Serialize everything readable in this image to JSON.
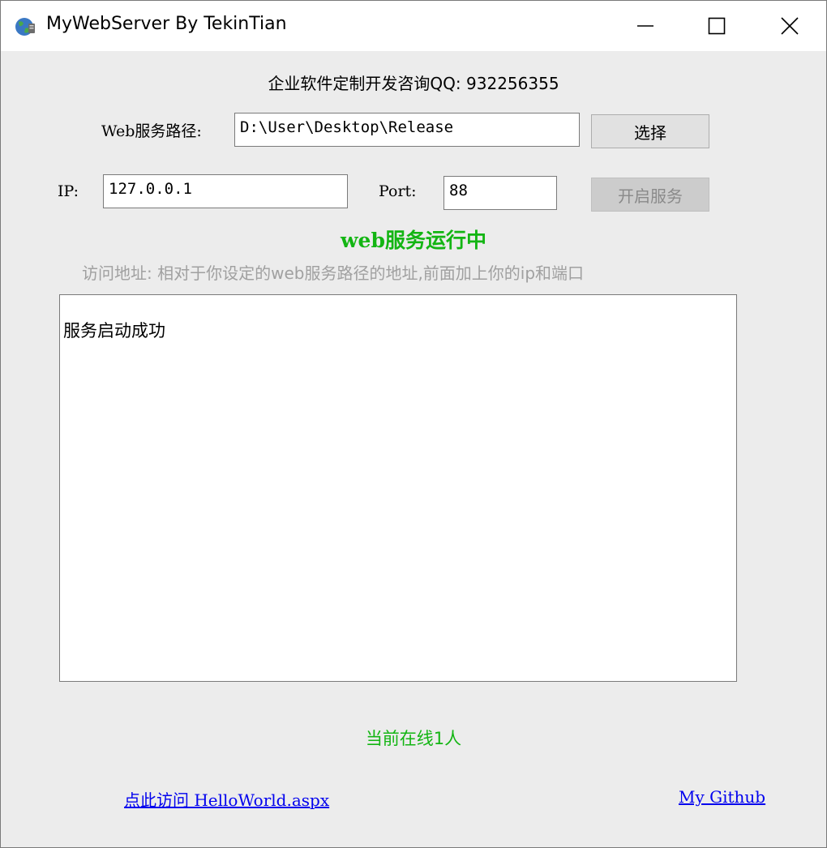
{
  "window": {
    "title": "MyWebServer By TekinTian",
    "icon": "globe-icon"
  },
  "header": {
    "qq_text": "企业软件定制开发咨询QQ: 932256355"
  },
  "path_row": {
    "label": "Web服务路径:",
    "value": "D:\\User\\Desktop\\Release",
    "choose_button": "选择"
  },
  "network_row": {
    "ip_label": "IP:",
    "ip_value": "127.0.0.1",
    "port_label": "Port:",
    "port_value": "88",
    "start_button": "开启服务",
    "start_button_enabled": false
  },
  "status": {
    "text": "web服务运行中",
    "color": "#13b513"
  },
  "hint": {
    "text": "访问地址: 相对于你设定的web服务路径的地址,前面加上你的ip和端口"
  },
  "log": {
    "lines": [
      "服务启动成功"
    ]
  },
  "online": {
    "text": "当前在线1人"
  },
  "footer": {
    "visit_link": "点此访问 HelloWorld.aspx",
    "github_link": "My Github"
  }
}
